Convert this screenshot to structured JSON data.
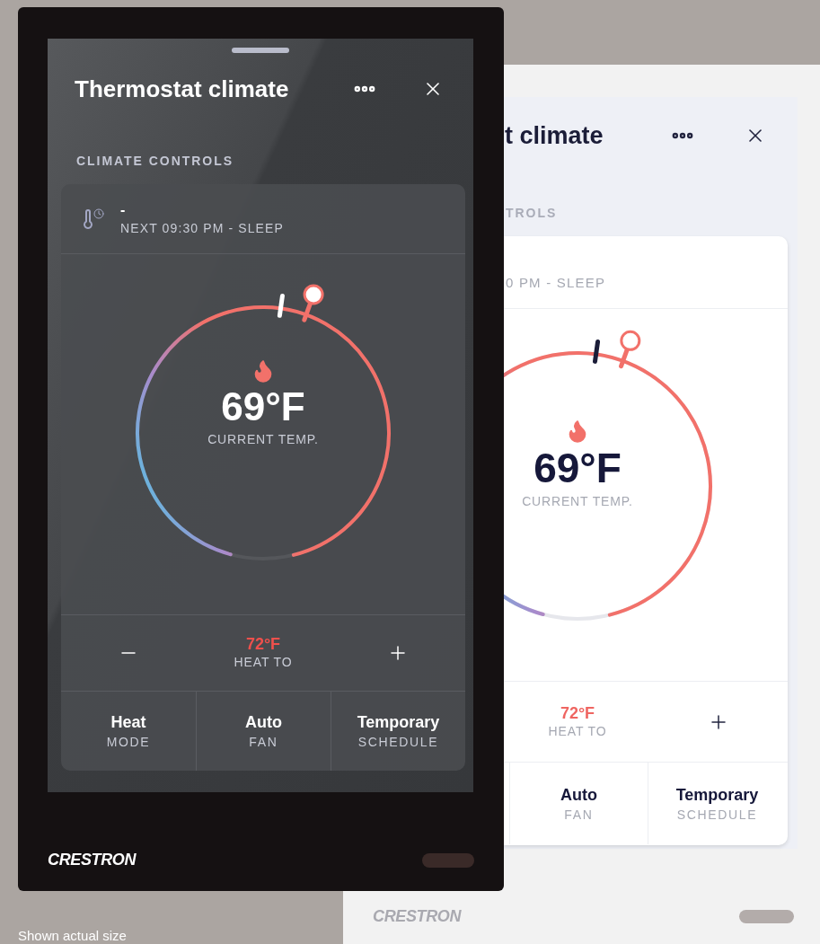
{
  "devices": [
    {
      "kind": "light",
      "title": "t climate",
      "section": "TROLS",
      "schedule_note": "0 PM - SLEEP",
      "current_temp": "69°F",
      "current_label": "CURRENT TEMP.",
      "setpoint": "72°F",
      "setpoint_label": "HEAT TO",
      "tiles": [
        {
          "value": "Auto",
          "label": "FAN"
        },
        {
          "value": "Temporary",
          "label": "SCHEDULE"
        }
      ],
      "logo": "CRESTRON"
    },
    {
      "kind": "dark",
      "title": "Thermostat climate",
      "section": "CLIMATE CONTROLS",
      "status": "-",
      "schedule_note": "NEXT 09:30 PM - SLEEP",
      "current_temp": "69°F",
      "current_label": "CURRENT TEMP.",
      "setpoint": "72°F",
      "setpoint_label": "HEAT TO",
      "tiles": [
        {
          "value": "Heat",
          "label": "MODE"
        },
        {
          "value": "Auto",
          "label": "FAN"
        },
        {
          "value": "Temporary",
          "label": "SCHEDULE"
        }
      ],
      "logo": "CRESTRON"
    }
  ],
  "caption": "Shown actual size"
}
